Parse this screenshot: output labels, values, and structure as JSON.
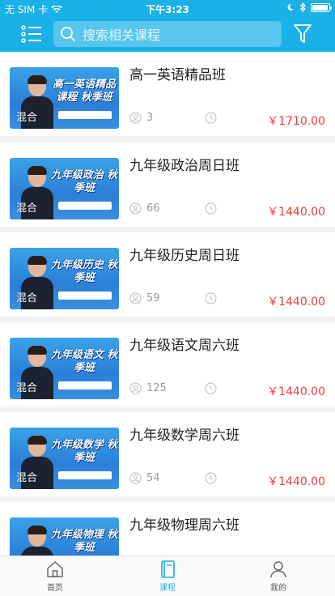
{
  "status_bar": {
    "carrier": "无 SIM 卡",
    "time": "下午3:23"
  },
  "header": {
    "search_placeholder": "搜索相关课程"
  },
  "courses": [
    {
      "title": "高一英语精品班",
      "thumb_banner": "高一英语精品课程 秋季班",
      "thumb_tag": "混合",
      "students": "3",
      "price": "￥1710.00"
    },
    {
      "title": "九年级政治周日班",
      "thumb_banner": "九年级政治 秋季班",
      "thumb_tag": "混合",
      "students": "66",
      "price": "￥1440.00"
    },
    {
      "title": "九年级历史周日班",
      "thumb_banner": "九年级历史 秋季班",
      "thumb_tag": "混合",
      "students": "59",
      "price": "￥1440.00"
    },
    {
      "title": "九年级语文周六班",
      "thumb_banner": "九年级语文 秋季班",
      "thumb_tag": "混合",
      "students": "125",
      "price": "￥1440.00"
    },
    {
      "title": "九年级数学周六班",
      "thumb_banner": "九年级数学 秋季班",
      "thumb_tag": "混合",
      "students": "54",
      "price": "￥1440.00"
    },
    {
      "title": "九年级物理周六班",
      "thumb_banner": "九年级物理 秋季班",
      "thumb_tag": "",
      "students": "",
      "price": ""
    }
  ],
  "tabbar": {
    "home": "首页",
    "courses": "课程",
    "mine": "我的"
  },
  "colors": {
    "accent": "#1ab0e8",
    "price": "#f03c3c"
  },
  "icons": [
    "menu-icon",
    "search-icon",
    "filter-icon",
    "user-icon",
    "clock-icon",
    "home-icon",
    "book-icon",
    "profile-icon"
  ]
}
